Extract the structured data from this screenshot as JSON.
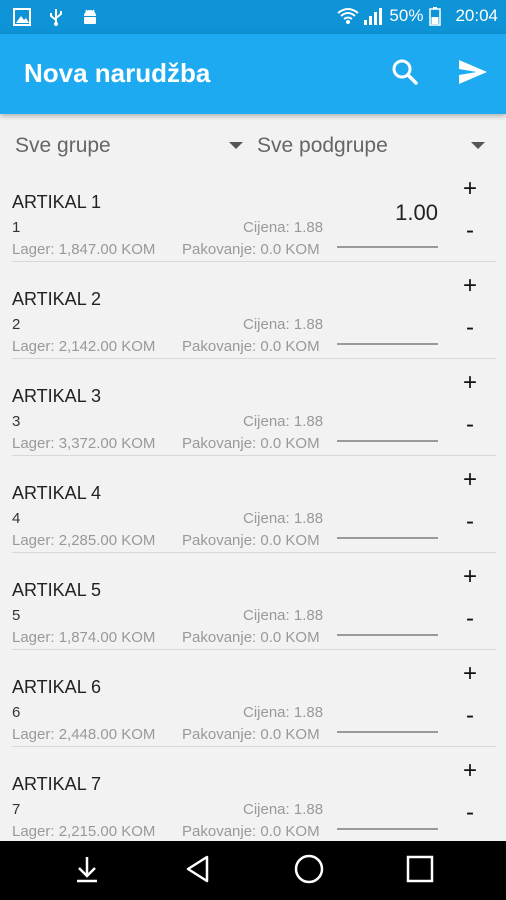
{
  "status_bar": {
    "battery": "50%",
    "time": "20:04",
    "icons": [
      "image-icon",
      "usb-icon",
      "android-icon",
      "wifi-icon",
      "signal-icon",
      "battery-icon"
    ]
  },
  "app_bar": {
    "title": "Nova narudžba",
    "actions": [
      "search-icon",
      "send-icon"
    ]
  },
  "filters": {
    "group": "Sve grupe",
    "subgroup": "Sve podgrupe"
  },
  "items": [
    {
      "name": "ARTIKAL 1",
      "code": "1",
      "price": "Cijena: 1.88",
      "stock": "Lager: 1,847.00 KOM",
      "packaging": "Pakovanje: 0.0 KOM",
      "quantity": "1.00"
    },
    {
      "name": "ARTIKAL 2",
      "code": "2",
      "price": "Cijena: 1.88",
      "stock": "Lager: 2,142.00 KOM",
      "packaging": "Pakovanje: 0.0 KOM",
      "quantity": ""
    },
    {
      "name": "ARTIKAL 3",
      "code": "3",
      "price": "Cijena: 1.88",
      "stock": "Lager: 3,372.00 KOM",
      "packaging": "Pakovanje: 0.0 KOM",
      "quantity": ""
    },
    {
      "name": "ARTIKAL 4",
      "code": "4",
      "price": "Cijena: 1.88",
      "stock": "Lager: 2,285.00 KOM",
      "packaging": "Pakovanje: 0.0 KOM",
      "quantity": ""
    },
    {
      "name": "ARTIKAL 5",
      "code": "5",
      "price": "Cijena: 1.88",
      "stock": "Lager: 1,874.00 KOM",
      "packaging": "Pakovanje: 0.0 KOM",
      "quantity": ""
    },
    {
      "name": "ARTIKAL 6",
      "code": "6",
      "price": "Cijena: 1.88",
      "stock": "Lager: 2,448.00 KOM",
      "packaging": "Pakovanje: 0.0 KOM",
      "quantity": ""
    },
    {
      "name": "ARTIKAL 7",
      "code": "7",
      "price": "Cijena: 1.88",
      "stock": "Lager: 2,215.00 KOM",
      "packaging": "Pakovanje: 0.0 KOM",
      "quantity": ""
    }
  ],
  "row_controls": {
    "plus": "+",
    "minus": "-"
  },
  "nav_bar": {
    "buttons": [
      "download-icon",
      "back-icon",
      "home-icon",
      "recents-icon"
    ]
  },
  "colors": {
    "status_bar": "#0d93d6",
    "app_bar": "#1eaaf1",
    "background": "#f2f2f2",
    "nav_bar": "#000000"
  }
}
